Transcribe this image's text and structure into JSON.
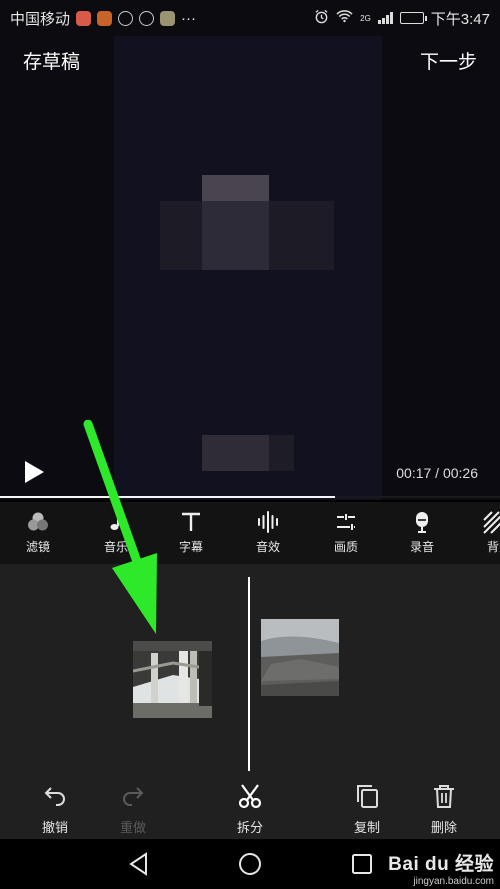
{
  "status_bar": {
    "carrier": "中国移动",
    "more": "···",
    "network": "2G",
    "time": "下午3:47"
  },
  "header": {
    "draft_label": "存草稿",
    "next_label": "下一步"
  },
  "player": {
    "time": "00:17 / 00:26",
    "progress": 0.67
  },
  "toolbar": {
    "items": [
      {
        "label": "滤镜",
        "icon": "filter-icon"
      },
      {
        "label": "音乐",
        "icon": "music-note-icon"
      },
      {
        "label": "字幕",
        "icon": "text-icon"
      },
      {
        "label": "音效",
        "icon": "sound-effect-icon"
      },
      {
        "label": "画质",
        "icon": "adjust-icon"
      },
      {
        "label": "录音",
        "icon": "microphone-icon"
      },
      {
        "label": "背景",
        "icon": "background-icon"
      }
    ]
  },
  "edit_actions": {
    "undo_label": "撤销",
    "redo_label": "重做",
    "split_label": "拆分",
    "copy_label": "复制",
    "delete_label": "删除"
  },
  "watermark": {
    "text": "Bai du 经验",
    "url": "jingyan.baidu.com"
  },
  "colors": {
    "annotation_arrow": "#2ee82a",
    "background": "#202020",
    "toolbar": "#131313"
  }
}
